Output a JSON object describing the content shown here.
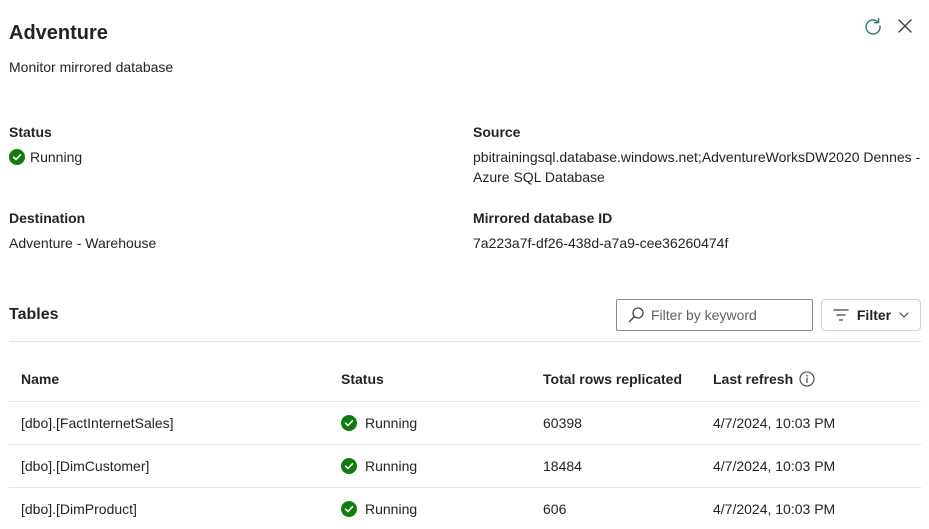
{
  "header": {
    "title": "Adventure",
    "subtitle": "Monitor mirrored database"
  },
  "details": {
    "status_label": "Status",
    "status_value": "Running",
    "source_label": "Source",
    "source_line1": "pbitrainingsql.database.windows.net;AdventureWorksDW2020 Dennes -",
    "source_line2": "Azure SQL Database",
    "destination_label": "Destination",
    "destination_value": "Adventure - Warehouse",
    "mirror_id_label": "Mirrored database ID",
    "mirror_id_value": "7a223a7f-df26-438d-a7a9-cee36260474f"
  },
  "tables": {
    "title": "Tables",
    "search_placeholder": "Filter by keyword",
    "filter_label": "Filter",
    "columns": [
      "Name",
      "Status",
      "Total rows replicated",
      "Last refresh"
    ],
    "rows": [
      {
        "name": "[dbo].[FactInternetSales]",
        "status": "Running",
        "rows": "60398",
        "last_refresh": "4/7/2024, 10:03 PM"
      },
      {
        "name": "[dbo].[DimCustomer]",
        "status": "Running",
        "rows": "18484",
        "last_refresh": "4/7/2024, 10:03 PM"
      },
      {
        "name": "[dbo].[DimProduct]",
        "status": "Running",
        "rows": "606",
        "last_refresh": "4/7/2024, 10:03 PM"
      }
    ]
  },
  "colors": {
    "success": "#107c10",
    "text": "#242424",
    "icon": "#616161"
  },
  "icons": [
    "refresh-icon",
    "close-icon",
    "check-circle-icon",
    "search-icon",
    "filter-icon",
    "chevron-down-icon",
    "info-icon"
  ]
}
